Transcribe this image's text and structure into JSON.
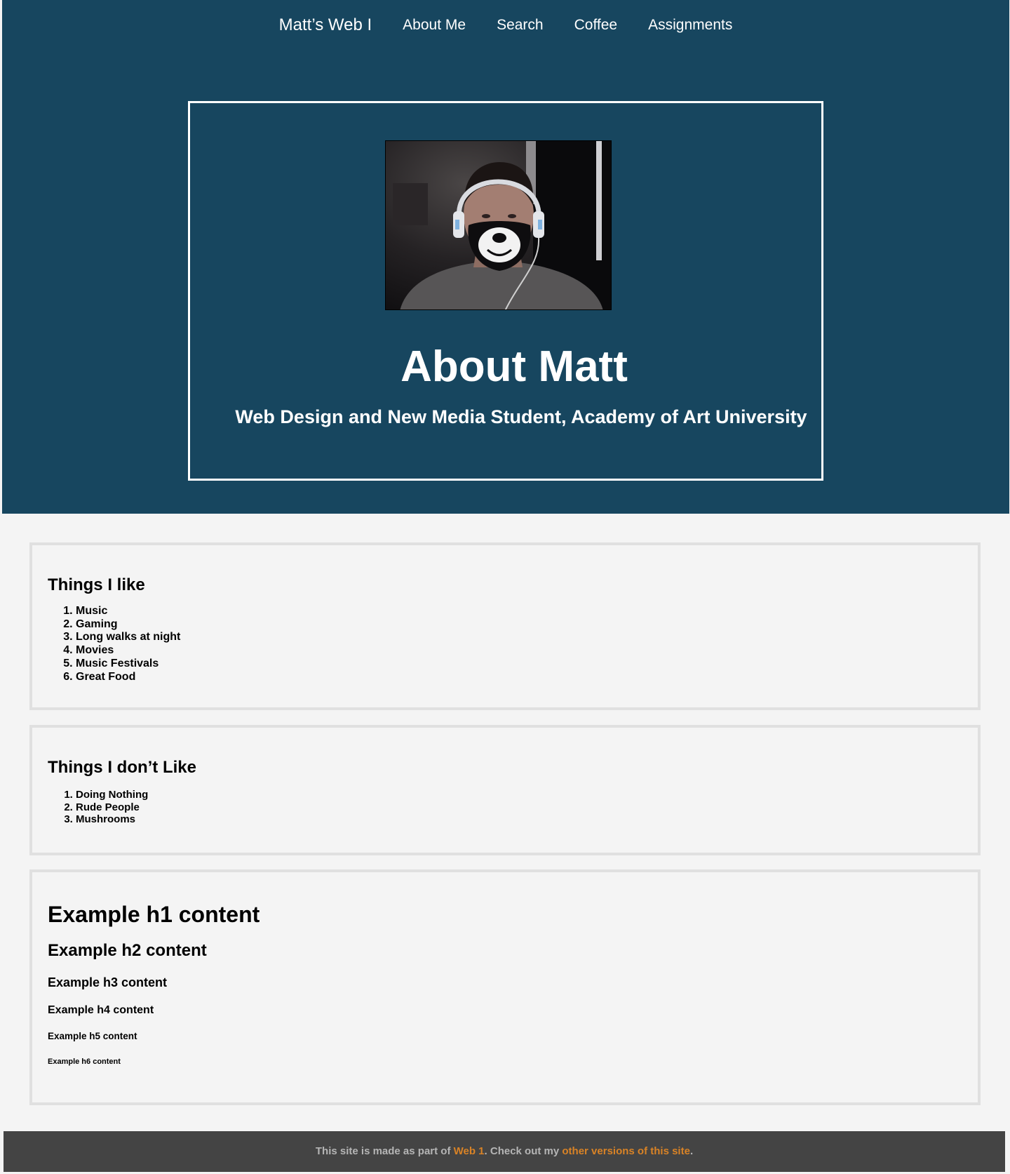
{
  "nav": {
    "brand": "Matt’s Web I",
    "links": [
      "About Me",
      "Search",
      "Coffee",
      "Assignments"
    ]
  },
  "hero": {
    "title": "About Matt",
    "subtitle": "Web Design and New Media Student, Academy of Art University"
  },
  "likes": {
    "heading": "Things I like",
    "items": [
      "Music",
      "Gaming",
      "Long walks at night",
      "Movies",
      "Music Festivals",
      "Great Food"
    ]
  },
  "dislikes": {
    "heading": "Things I don’t Like",
    "items": [
      "Doing Nothing",
      "Rude People",
      "Mushrooms"
    ]
  },
  "headings_demo": {
    "h1": "Example h1 content",
    "h2": "Example h2 content",
    "h3": "Example h3 content",
    "h4": "Example h4 content",
    "h5": "Example h5 content",
    "h6": "Example h6 content"
  },
  "footer": {
    "text_before": "This site is made as part of ",
    "link1": "Web 1",
    "text_middle": ". Check out my ",
    "link2": "other versions of this site",
    "text_after": "."
  },
  "colors": {
    "hero_bg": "#17465f",
    "page_bg": "#f4f4f4",
    "card_border": "#e0e0e0",
    "footer_bg": "#444444",
    "footer_text": "#b5b5b5",
    "footer_link": "#d98326"
  }
}
